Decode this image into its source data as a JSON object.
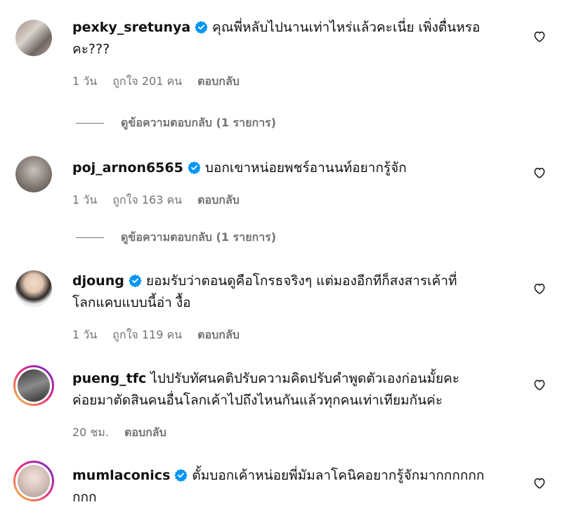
{
  "comments": [
    {
      "username": "pexky_sretunya",
      "verified": true,
      "text_lines": [
        "คุณพี่หลับไปนานเท่าไหร่แล้วคะเนี่ย เพิ่งตื่นหรอ",
        "คะ???"
      ],
      "time": "1 วัน",
      "likes": "ถูกใจ 201 คน",
      "reply_label": "ตอบกลับ",
      "view_replies": "ดูข้อความตอบกลับ (1 รายการ)"
    },
    {
      "username": "poj_arnon6565",
      "verified": true,
      "text_lines": [
        "บอกเขาหน่อยพชร์อานนท์อยากรู้จัก"
      ],
      "time": "1 วัน",
      "likes": "ถูกใจ 163 คน",
      "reply_label": "ตอบกลับ",
      "view_replies": "ดูข้อความตอบกลับ (1 รายการ)"
    },
    {
      "username": "djoung",
      "verified": true,
      "text_lines": [
        "ยอมรับว่าตอนดูคือโกรธจริงๆ แต่มองอีกทีก็สงสารเค้าที่",
        "โลกแคบแบบนี้อ่า งื้อ"
      ],
      "time": "1 วัน",
      "likes": "ถูกใจ 119 คน",
      "reply_label": "ตอบกลับ"
    },
    {
      "username": "pueng_tfc",
      "verified": false,
      "text_lines": [
        "ไปปรับทัศนคติปรับความคิดปรับคำพูดตัวเองก่อนมั้ยคะ",
        "ค่อยมาตัดสินคนอื่นโลกเค้าไปถึงไหนกันแล้วทุกคนเท่าเทียมกันค่ะ"
      ],
      "time": "20 ชม.",
      "reply_label": "ตอบกลับ"
    },
    {
      "username": "mumlaconics",
      "verified": true,
      "text_lines": [
        "ตั้มบอกเค้าหน่อยพี่มัมลาโคนิคอยากรู้จักมากกกกกก",
        "กกก"
      ]
    }
  ],
  "colors": {
    "verified": "#0095f6",
    "meta_text": "#737373",
    "story_ring": [
      "#f9ce34",
      "#ee2a7b",
      "#6228d7"
    ]
  },
  "icons": {
    "verified": "verified-badge-icon",
    "like": "heart-outline-icon"
  }
}
